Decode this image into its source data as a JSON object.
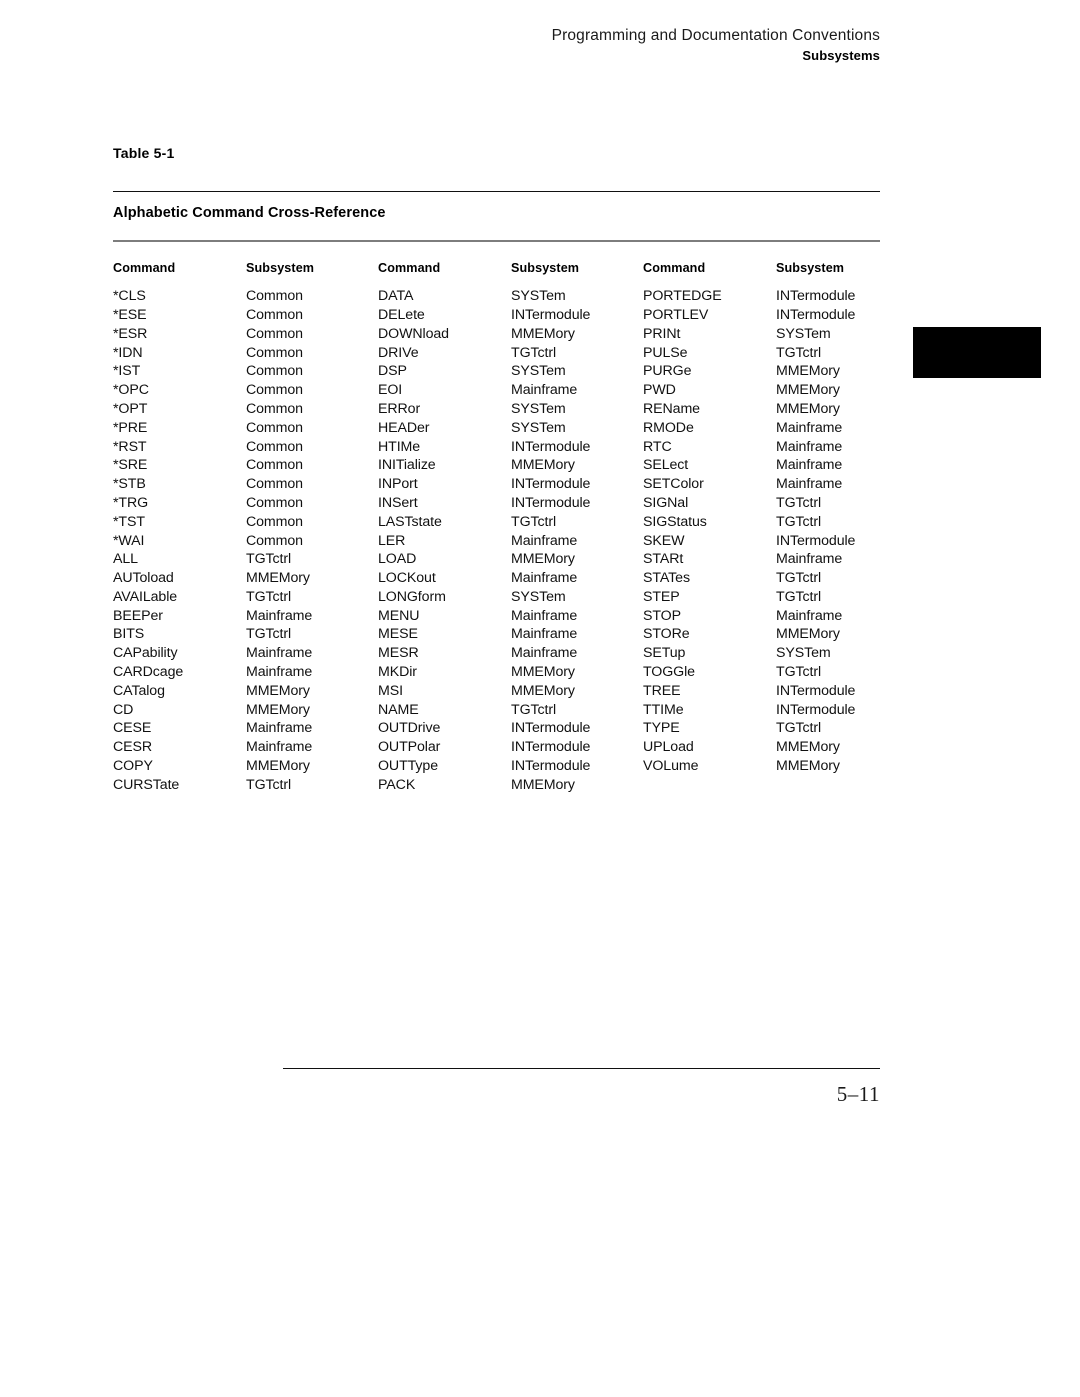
{
  "running_head": {
    "title": "Programming and Documentation Conventions",
    "subtitle": "Subsystems"
  },
  "table": {
    "number": "Table 5-1",
    "title": "Alphabetic Command Cross-Reference",
    "headers": [
      "Command",
      "Subsystem",
      "Command",
      "Subsystem",
      "Command",
      "Subsystem"
    ],
    "column_groups": [
      {
        "command_header": "Command",
        "subsystem_header": "Subsystem",
        "rows": [
          {
            "command": "*CLS",
            "subsystem": "Common"
          },
          {
            "command": "*ESE",
            "subsystem": "Common"
          },
          {
            "command": "*ESR",
            "subsystem": "Common"
          },
          {
            "command": "*IDN",
            "subsystem": "Common"
          },
          {
            "command": "*IST",
            "subsystem": "Common"
          },
          {
            "command": "*OPC",
            "subsystem": "Common"
          },
          {
            "command": "*OPT",
            "subsystem": "Common"
          },
          {
            "command": "*PRE",
            "subsystem": "Common"
          },
          {
            "command": "*RST",
            "subsystem": "Common"
          },
          {
            "command": "*SRE",
            "subsystem": "Common"
          },
          {
            "command": "*STB",
            "subsystem": "Common"
          },
          {
            "command": "*TRG",
            "subsystem": "Common"
          },
          {
            "command": "*TST",
            "subsystem": "Common"
          },
          {
            "command": "*WAI",
            "subsystem": "Common"
          },
          {
            "command": "ALL",
            "subsystem": "TGTctrl"
          },
          {
            "command": "AUToload",
            "subsystem": "MMEMory"
          },
          {
            "command": "AVAILable",
            "subsystem": "TGTctrl"
          },
          {
            "command": "BEEPer",
            "subsystem": "Mainframe"
          },
          {
            "command": "BITS",
            "subsystem": "TGTctrl"
          },
          {
            "command": "CAPability",
            "subsystem": "Mainframe"
          },
          {
            "command": "CARDcage",
            "subsystem": "Mainframe"
          },
          {
            "command": "CATalog",
            "subsystem": "MMEMory"
          },
          {
            "command": "CD",
            "subsystem": "MMEMory"
          },
          {
            "command": "CESE",
            "subsystem": "Mainframe"
          },
          {
            "command": "CESR",
            "subsystem": "Mainframe"
          },
          {
            "command": "COPY",
            "subsystem": "MMEMory"
          },
          {
            "command": "CURSTate",
            "subsystem": "TGTctrl"
          }
        ]
      },
      {
        "command_header": "Command",
        "subsystem_header": "Subsystem",
        "rows": [
          {
            "command": "DATA",
            "subsystem": "SYSTem"
          },
          {
            "command": "DELete",
            "subsystem": "INTermodule"
          },
          {
            "command": "DOWNload",
            "subsystem": "MMEMory"
          },
          {
            "command": "DRIVe",
            "subsystem": "TGTctrl"
          },
          {
            "command": "DSP",
            "subsystem": "SYSTem"
          },
          {
            "command": "EOI",
            "subsystem": "Mainframe"
          },
          {
            "command": "ERRor",
            "subsystem": "SYSTem"
          },
          {
            "command": "HEADer",
            "subsystem": "SYSTem"
          },
          {
            "command": "HTIMe",
            "subsystem": "INTermodule"
          },
          {
            "command": "INITialize",
            "subsystem": "MMEMory"
          },
          {
            "command": "INPort",
            "subsystem": "INTermodule"
          },
          {
            "command": "INSert",
            "subsystem": "INTermodule"
          },
          {
            "command": "LASTstate",
            "subsystem": "TGTctrl"
          },
          {
            "command": "LER",
            "subsystem": "Mainframe"
          },
          {
            "command": "LOAD",
            "subsystem": "MMEMory"
          },
          {
            "command": "LOCKout",
            "subsystem": "Mainframe"
          },
          {
            "command": "LONGform",
            "subsystem": "SYSTem"
          },
          {
            "command": "MENU",
            "subsystem": "Mainframe"
          },
          {
            "command": "MESE",
            "subsystem": "Mainframe"
          },
          {
            "command": "MESR",
            "subsystem": "Mainframe"
          },
          {
            "command": "MKDir",
            "subsystem": "MMEMory"
          },
          {
            "command": "MSI",
            "subsystem": "MMEMory"
          },
          {
            "command": "NAME",
            "subsystem": "TGTctrl"
          },
          {
            "command": "OUTDrive",
            "subsystem": "INTermodule"
          },
          {
            "command": "OUTPolar",
            "subsystem": "INTermodule"
          },
          {
            "command": "OUTType",
            "subsystem": "INTermodule"
          },
          {
            "command": "PACK",
            "subsystem": "MMEMory"
          }
        ]
      },
      {
        "command_header": "Command",
        "subsystem_header": "Subsystem",
        "rows": [
          {
            "command": "PORTEDGE",
            "subsystem": "INTermodule"
          },
          {
            "command": "PORTLEV",
            "subsystem": "INTermodule"
          },
          {
            "command": "PRINt",
            "subsystem": "SYSTem"
          },
          {
            "command": "PULSe",
            "subsystem": "TGTctrl"
          },
          {
            "command": "PURGe",
            "subsystem": "MMEMory"
          },
          {
            "command": "PWD",
            "subsystem": "MMEMory"
          },
          {
            "command": "REName",
            "subsystem": "MMEMory"
          },
          {
            "command": "RMODe",
            "subsystem": "Mainframe"
          },
          {
            "command": "RTC",
            "subsystem": "Mainframe"
          },
          {
            "command": "SELect",
            "subsystem": "Mainframe"
          },
          {
            "command": "SETColor",
            "subsystem": "Mainframe"
          },
          {
            "command": "SIGNal",
            "subsystem": "TGTctrl"
          },
          {
            "command": "SIGStatus",
            "subsystem": "TGTctrl"
          },
          {
            "command": "SKEW",
            "subsystem": "INTermodule"
          },
          {
            "command": "STARt",
            "subsystem": "Mainframe"
          },
          {
            "command": "STATes",
            "subsystem": "TGTctrl"
          },
          {
            "command": "STEP",
            "subsystem": "TGTctrl"
          },
          {
            "command": "STOP",
            "subsystem": "Mainframe"
          },
          {
            "command": "STORe",
            "subsystem": "MMEMory"
          },
          {
            "command": "SETup",
            "subsystem": "SYSTem"
          },
          {
            "command": "TOGGle",
            "subsystem": "TGTctrl"
          },
          {
            "command": "TREE",
            "subsystem": "INTermodule"
          },
          {
            "command": "TTIMe",
            "subsystem": "INTermodule"
          },
          {
            "command": "TYPE",
            "subsystem": "TGTctrl"
          },
          {
            "command": "UPLoad",
            "subsystem": "MMEMory"
          },
          {
            "command": "VOLume",
            "subsystem": "MMEMory"
          },
          {
            "command": "",
            "subsystem": ""
          }
        ]
      }
    ]
  },
  "footer": {
    "page_number": "5–11"
  },
  "colors": {
    "text": "#111111",
    "rule_thin": "#111111",
    "rule_thick": "#7d7d7d",
    "thumb_tab": "#000000",
    "page_background": "#ffffff"
  }
}
